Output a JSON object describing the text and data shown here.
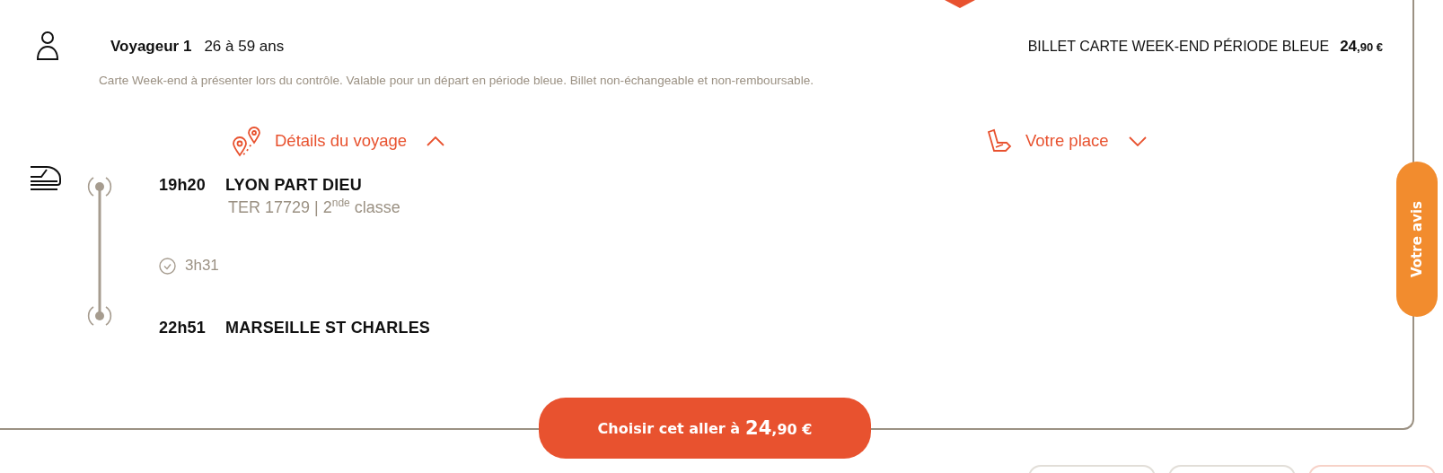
{
  "traveler": {
    "label": "Voyageur 1",
    "age": "26 à 59 ans"
  },
  "fare": {
    "name": "BILLET CARTE WEEK-END PÉRIODE BLEUE",
    "price_units": "24",
    "price_cents": ",90 €"
  },
  "conditions": "Carte Week-end à présenter lors du contrôle. Valable pour un départ en période bleue. Billet non-échangeable et non-remboursable.",
  "toggles": [
    {
      "kind": "trip",
      "label": "Détails du voyage",
      "expanded": true
    },
    {
      "kind": "seat",
      "label": "Votre place",
      "expanded": false
    }
  ],
  "journey": {
    "departure": {
      "time": "19h20",
      "station": "LYON PART DIEU"
    },
    "train": "TER 17729 | 2$^{nde}$ classe",
    "duration": "3h31",
    "arrival": {
      "time": "22h51",
      "station": "MARSEILLE ST CHARLES"
    }
  },
  "choose_button": {
    "label": "Choisir cet aller à",
    "price_units": "24",
    "price_cents": ",90 €"
  },
  "feedback_tab": "Votre avis"
}
